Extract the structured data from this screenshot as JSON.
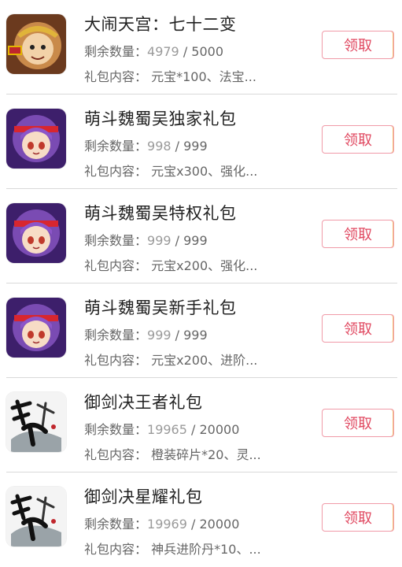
{
  "colors": {
    "accent": "#e0475f",
    "button_border": "#f09aa8",
    "divider": "#d9d9d9"
  },
  "labels": {
    "remain_prefix": "剩余数量：",
    "content_prefix": "礼包内容：",
    "slash": " / "
  },
  "gifts": [
    {
      "icon": "monkey-king-game-icon",
      "title": "大闹天宫：七十二变",
      "remain": "4979",
      "total": "5000",
      "content": "元宝*100、法宝...",
      "button": "领取"
    },
    {
      "icon": "anime-girl-game-icon",
      "title": "萌斗魏蜀吴独家礼包",
      "remain": "998",
      "total": "999",
      "content": "元宝x300、强化...",
      "button": "领取"
    },
    {
      "icon": "anime-girl-game-icon",
      "title": "萌斗魏蜀吴特权礼包",
      "remain": "999",
      "total": "999",
      "content": "元宝x200、强化...",
      "button": "领取"
    },
    {
      "icon": "anime-girl-game-icon",
      "title": "萌斗魏蜀吴新手礼包",
      "remain": "999",
      "total": "999",
      "content": "元宝x200、进阶...",
      "button": "领取"
    },
    {
      "icon": "calligraphy-sword-game-icon",
      "title": "御剑决王者礼包",
      "remain": "19965",
      "total": "20000",
      "content": "橙装碎片*20、灵...",
      "button": "领取"
    },
    {
      "icon": "calligraphy-sword-game-icon",
      "title": "御剑决星耀礼包",
      "remain": "19969",
      "total": "20000",
      "content": "神兵进阶丹*10、...",
      "button": "领取"
    }
  ]
}
